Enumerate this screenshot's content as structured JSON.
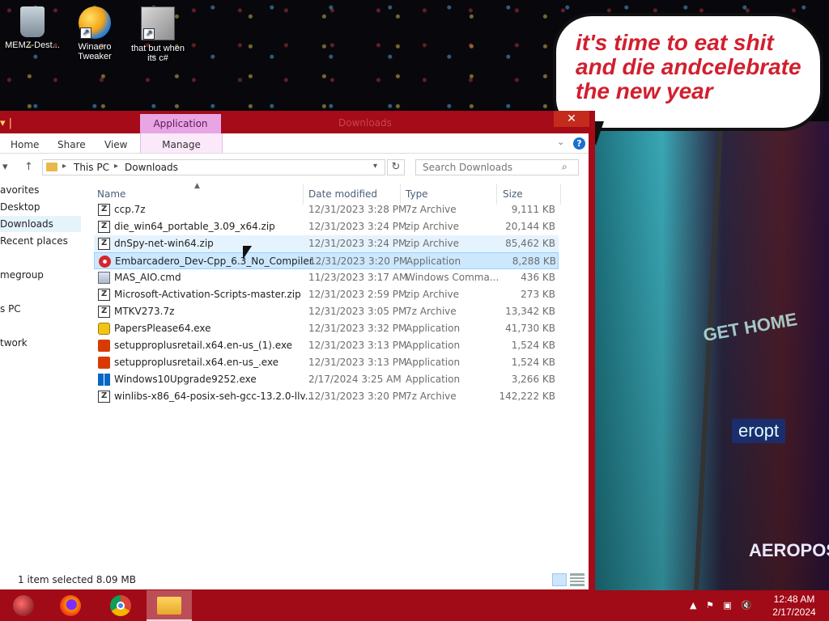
{
  "desktop": {
    "icons": [
      {
        "label": "MEMZ-Dest..."
      },
      {
        "label": "Winaero Tweaker"
      },
      {
        "label": "that but when its c#"
      }
    ],
    "bubble_text": "it's time to eat shit and die andcelebrate the new year",
    "billboard_text": "GET HOME",
    "sign_text": "eropt",
    "sign2_text": "AEROPOS",
    "colors": {
      "bubble_text": "#d21f2e",
      "frame": "#a50b18"
    }
  },
  "window": {
    "title": "Downloads",
    "context_tab": "Application Tools",
    "ribbon_tabs": [
      "Home",
      "Share",
      "View",
      "Manage"
    ],
    "address": {
      "crumbs": [
        "This PC",
        "Downloads"
      ]
    },
    "search": {
      "placeholder": "Search Downloads"
    },
    "nav": [
      "avorites",
      "Desktop",
      "Downloads",
      "Recent places",
      "megroup",
      "s PC",
      "twork"
    ],
    "columns": [
      "Name",
      "Date modified",
      "Type",
      "Size"
    ],
    "files": [
      {
        "name": "ccp.7z",
        "date": "12/31/2023 3:28 PM",
        "type": "7z Archive",
        "size": "9,111 KB",
        "icon": "archive-icon"
      },
      {
        "name": "die_win64_portable_3.09_x64.zip",
        "date": "12/31/2023 3:24 PM",
        "type": "zip Archive",
        "size": "20,144 KB",
        "icon": "archive-icon"
      },
      {
        "name": "dnSpy-net-win64.zip",
        "date": "12/31/2023 3:24 PM",
        "type": "zip Archive",
        "size": "85,462 KB",
        "icon": "archive-icon"
      },
      {
        "name": "Embarcadero_Dev-Cpp_6.3_No_Compiler...",
        "date": "12/31/2023 3:20 PM",
        "type": "Application",
        "size": "8,288 KB",
        "icon": "app-icon"
      },
      {
        "name": "MAS_AIO.cmd",
        "date": "11/23/2023 3:17 AM",
        "type": "Windows Comma...",
        "size": "436 KB",
        "icon": "cmd-icon"
      },
      {
        "name": "Microsoft-Activation-Scripts-master.zip",
        "date": "12/31/2023 2:59 PM",
        "type": "zip Archive",
        "size": "273 KB",
        "icon": "archive-icon"
      },
      {
        "name": "MTKV273.7z",
        "date": "12/31/2023 3:05 PM",
        "type": "7z Archive",
        "size": "13,342 KB",
        "icon": "archive-icon"
      },
      {
        "name": "PapersPlease64.exe",
        "date": "12/31/2023 3:32 PM",
        "type": "Application",
        "size": "41,730 KB",
        "icon": "papers-please-icon"
      },
      {
        "name": "setupproplusretail.x64.en-us_(1).exe",
        "date": "12/31/2023 3:13 PM",
        "type": "Application",
        "size": "1,524 KB",
        "icon": "office-icon"
      },
      {
        "name": "setupproplusretail.x64.en-us_.exe",
        "date": "12/31/2023 3:13 PM",
        "type": "Application",
        "size": "1,524 KB",
        "icon": "office-icon"
      },
      {
        "name": "Windows10Upgrade9252.exe",
        "date": "2/17/2024 3:25 AM",
        "type": "Application",
        "size": "3,266 KB",
        "icon": "windows-icon"
      },
      {
        "name": "winlibs-x86_64-posix-seh-gcc-13.2.0-llv...",
        "date": "12/31/2023 3:20 PM",
        "type": "7z Archive",
        "size": "142,222 KB",
        "icon": "archive-icon"
      }
    ],
    "selected_index": 3,
    "hover_index": 2,
    "status": "1 item selected  8.09 MB"
  },
  "taskbar": {
    "clock_time": "12:48 AM",
    "clock_date": "2/17/2024"
  }
}
